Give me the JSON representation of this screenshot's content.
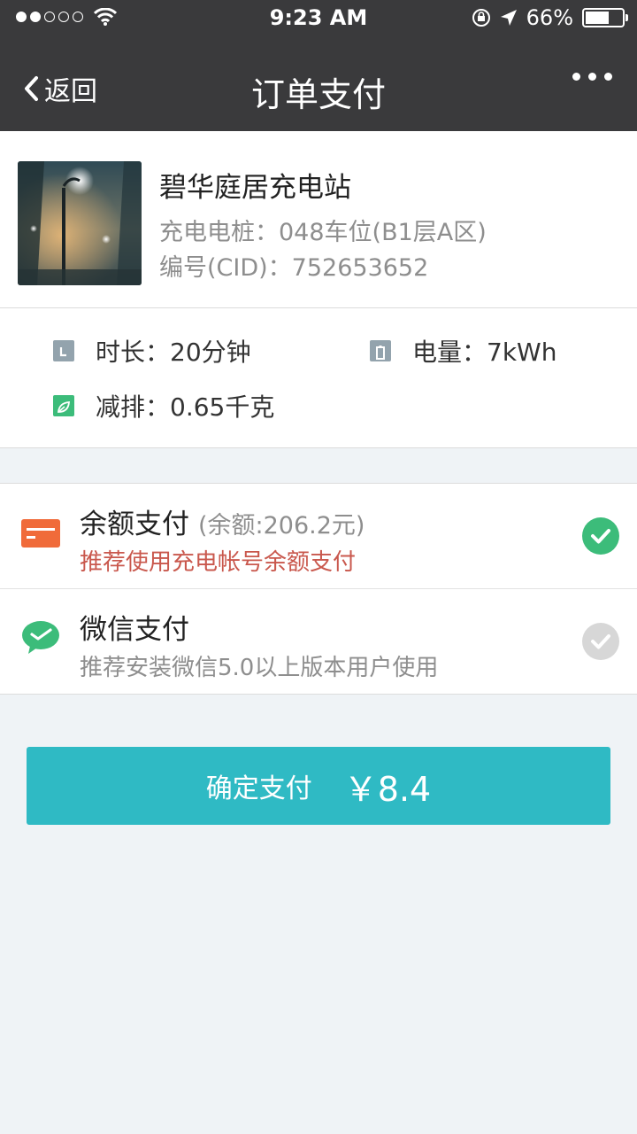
{
  "status_bar": {
    "time": "9:23 AM",
    "battery": "66%",
    "signal_bars_filled": 2,
    "signal_bars_total": 5,
    "battery_level": 0.66
  },
  "nav": {
    "back_label": "返回",
    "title": "订单支付"
  },
  "station": {
    "name": "碧华庭居充电站",
    "pile": "充电电桩：048车位(B1层A区)",
    "cid": "编号(CID)：752653652"
  },
  "stats": {
    "duration": "时长：20分钟",
    "energy": "电量：7kWh",
    "emission": "减排：0.65千克"
  },
  "payment": {
    "balance": {
      "title": "余额支付",
      "balance_text": "(余额:206.2元)",
      "desc": "推荐使用充电帐号余额支付",
      "selected": true
    },
    "wechat": {
      "title": "微信支付",
      "desc": "推荐安装微信5.0以上版本用户使用",
      "selected": false
    }
  },
  "confirm": {
    "label": "确定支付",
    "amount": "￥8.4"
  },
  "colors": {
    "nav_bg": "#3a3a3c",
    "accent": "#2fbac4",
    "check_on": "#3cbc7a",
    "warning_text": "#c9584d",
    "balance_icon": "#f06b3a"
  }
}
